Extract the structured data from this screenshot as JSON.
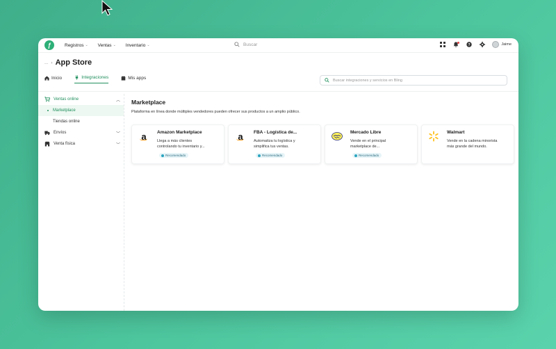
{
  "topbar": {
    "nav": [
      {
        "label": "Registros"
      },
      {
        "label": "Ventas"
      },
      {
        "label": "Inventario"
      }
    ],
    "search_placeholder": "Buscar",
    "user_name": "Jaime"
  },
  "header": {
    "breadcrumb_prefix": "...",
    "title": "App Store",
    "tabs": [
      {
        "label": "Inicio"
      },
      {
        "label": "Integraciones"
      },
      {
        "label": "Mis apps"
      }
    ],
    "search_placeholder": "Buscar integraciones y servicios en Bling"
  },
  "sidebar": {
    "groups": [
      {
        "label": "Ventas online"
      },
      {
        "label": "Envíos"
      },
      {
        "label": "Venta física"
      }
    ],
    "items": [
      {
        "label": "Marketplace"
      },
      {
        "label": "Tiendas online"
      }
    ]
  },
  "main": {
    "title": "Marketplace",
    "description": "Plataforma en línea donde múltiples vendedores pueden ofrecer sus productos a un amplio público.",
    "cards": [
      {
        "name": "Amazon Marketplace",
        "line1": "Llega a más clientes",
        "line2": "controlando tu inventario y...",
        "badge": "Recomendado",
        "icon": "amazon-icon"
      },
      {
        "name": "FBA - Logística de...",
        "line1": "Automatiza tu logística y",
        "line2": "simplifica tus ventas.",
        "badge": "Recomendado",
        "icon": "amazon-icon"
      },
      {
        "name": "Mercado Libre",
        "line1": "Vende en el principal",
        "line2": "marketplace de...",
        "badge": "Recomendado",
        "icon": "mercadolibre-icon"
      },
      {
        "name": "Walmart",
        "line1": "Vende en la cadena minorista",
        "line2": "más grande del mundo.",
        "icon": "walmart-icon"
      }
    ]
  },
  "colors": {
    "accent": "#21905e",
    "background": "#4cc49c",
    "badge_bg": "#e6f4f8"
  }
}
